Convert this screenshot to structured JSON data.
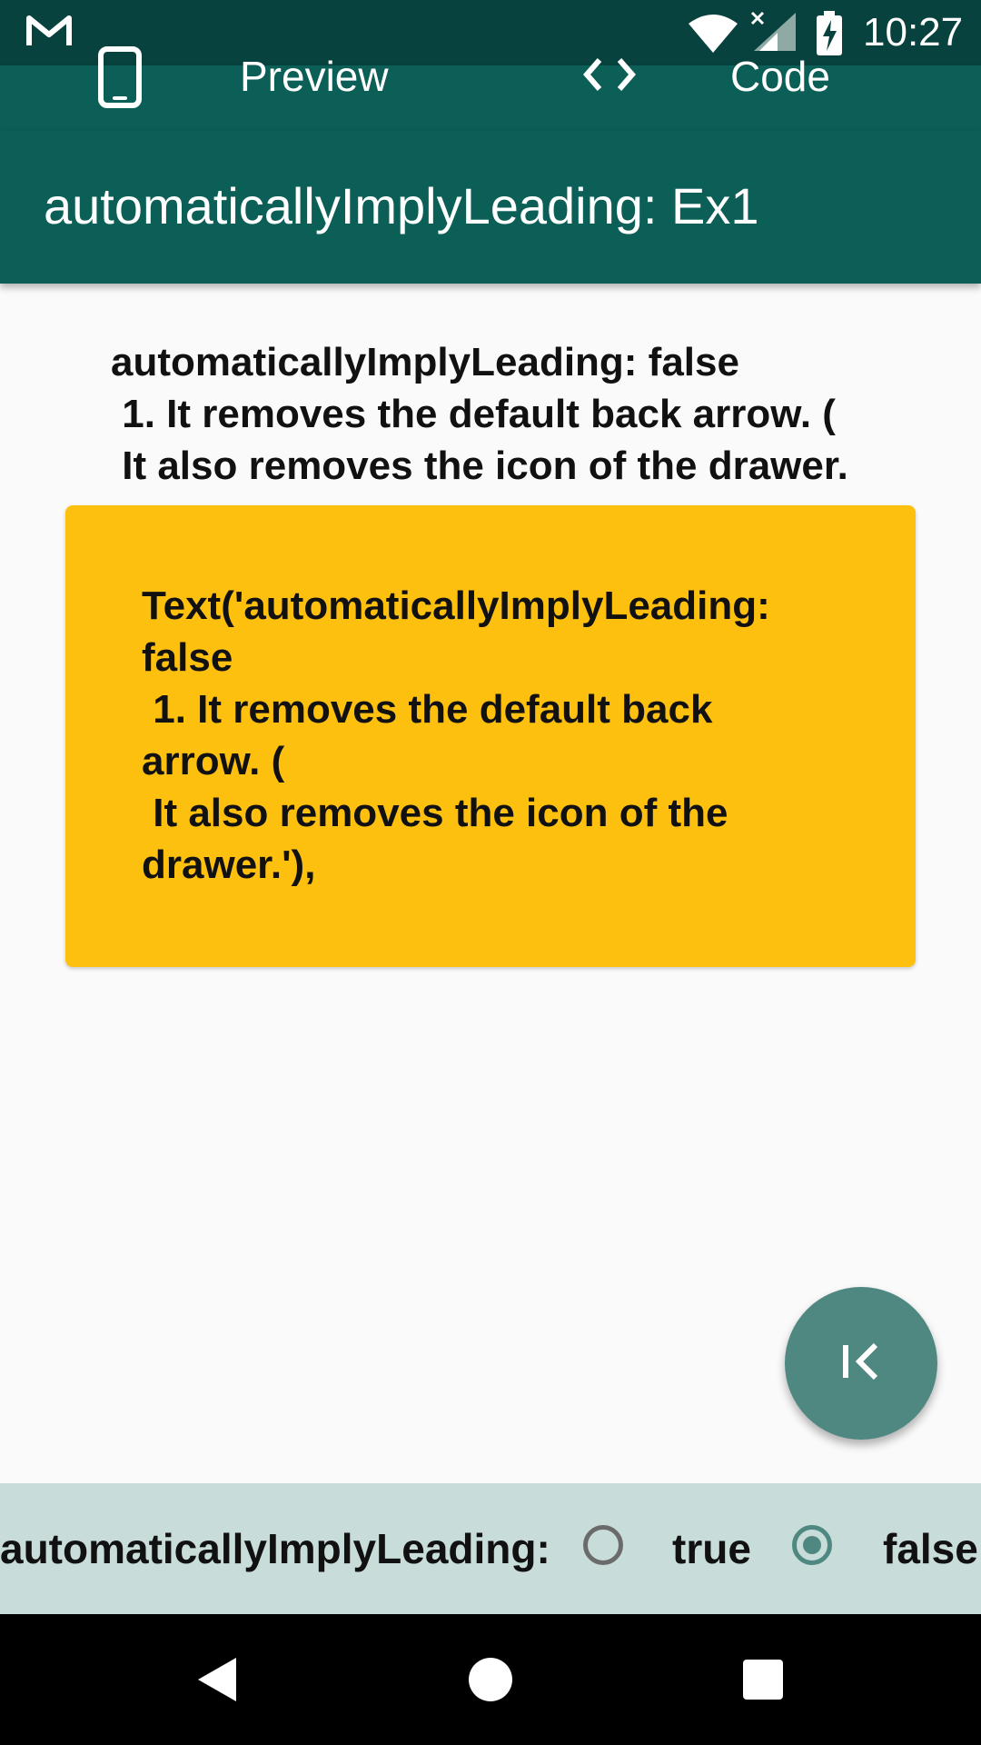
{
  "status_bar": {
    "time": "10:27",
    "icons": [
      "gmail-icon",
      "wifi-icon",
      "signal-icon",
      "battery-icon"
    ]
  },
  "mode_bar": {
    "preview_label": "Preview",
    "code_label": "Code",
    "icons": [
      "phone-icon",
      "code-icon"
    ]
  },
  "app_bar": {
    "title": "automaticallyImplyLeading: Ex1"
  },
  "description": {
    "lines": [
      "automaticallyImplyLeading: false",
      " 1. It removes the default back arrow. (",
      " It also removes the icon of the drawer."
    ]
  },
  "code_card": {
    "text": "Text('automaticallyImplyLeading:\nfalse\n 1. It removes the default back\narrow. (\n It also removes the icon of the\ndrawer.'),",
    "background": "#fdc00f"
  },
  "fab": {
    "icon": "first-page-icon"
  },
  "radio_group": {
    "label": "automaticallyImplyLeading:",
    "options": [
      {
        "label": "true",
        "selected": false
      },
      {
        "label": "false",
        "selected": true
      }
    ]
  },
  "nav_bar": {
    "icons": [
      "back-icon",
      "home-icon",
      "recents-icon"
    ]
  },
  "colors": {
    "primary": "#0b5f57",
    "status_bar": "#07423e",
    "accent": "#4f8880",
    "panel": "#c8dcd9"
  }
}
